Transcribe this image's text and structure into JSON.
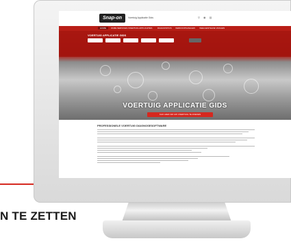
{
  "headline": "N TE ZETTEN",
  "site": {
    "logo_text": "Snap-on",
    "tagline": "Voertuig Applicatie Gids",
    "header_icons": "⚲ ◉ ▤",
    "nav": [
      "HOME",
      "ONZE SERVICES",
      "VOERTUIG APPLICATIES",
      "DIAGNOSTICS",
      "VERKOOPKANALEN",
      "VEELGESTELDE VRAGEN"
    ],
    "hero": {
      "panel_title": "VOERTUIG APPLICATIE GIDS",
      "selectors": [
        "Merk",
        "Model",
        "Type",
        "Jaar",
        "Motor"
      ],
      "search_button": "Zoeken",
      "big_title": "VOERTUIG APPLICATIE GIDS",
      "cta": "KLIK HIER OM UW VOERTUIG TE ZOEKEN"
    },
    "content_heading": "PROFESSIONELE VOERTUIG DIAGNOSESOFTWARE"
  }
}
